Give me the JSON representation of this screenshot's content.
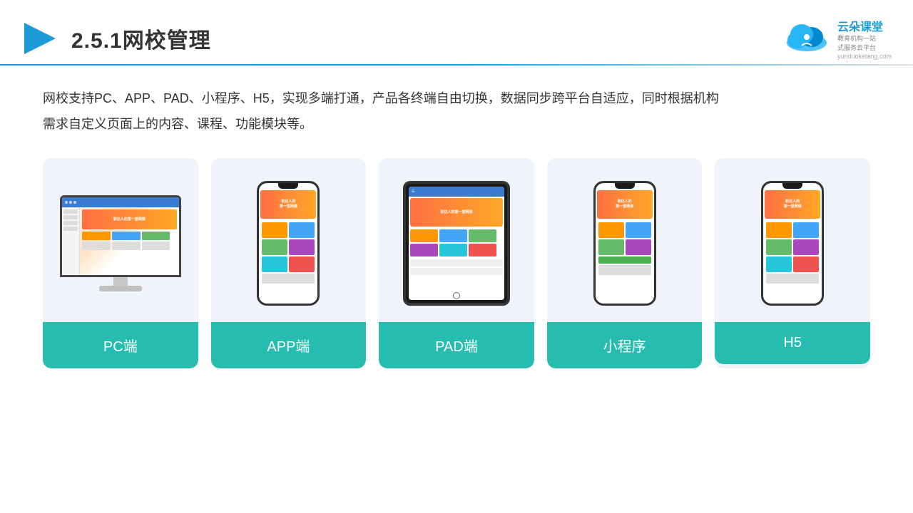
{
  "header": {
    "title": "2.5.1网校管理",
    "logo_url": "yunduoketang.com",
    "logo_tagline1": "教育机构一站",
    "logo_tagline2": "式服务云平台"
  },
  "description": {
    "line1": "网校支持PC、APP、PAD、小程序、H5，实现多端打通，产品各终端自由切换，数据同步跨平台自适应，同时根据机构",
    "line2": "需求自定义页面上的内容、课程、功能模块等。"
  },
  "cards": [
    {
      "id": "pc",
      "label": "PC端"
    },
    {
      "id": "app",
      "label": "APP端"
    },
    {
      "id": "pad",
      "label": "PAD端"
    },
    {
      "id": "miniprogram",
      "label": "小程序"
    },
    {
      "id": "h5",
      "label": "H5"
    }
  ]
}
